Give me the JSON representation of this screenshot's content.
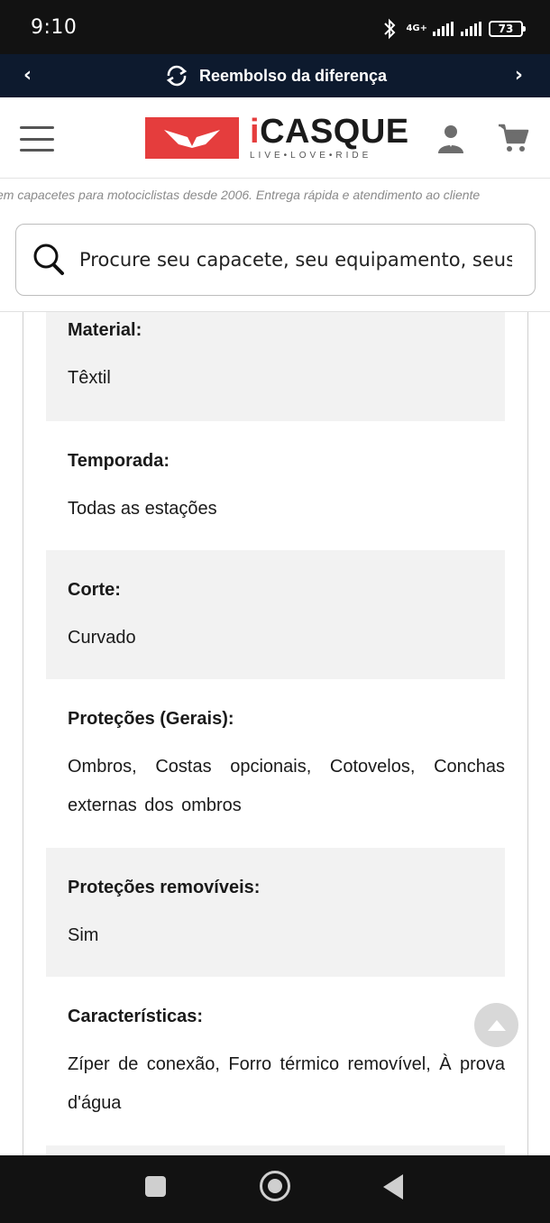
{
  "status_bar": {
    "time": "9:10",
    "network": "4G+",
    "battery": "73"
  },
  "promo": {
    "text": "Reembolso da diferença",
    "prev_icon": "chevron-left-icon",
    "next_icon": "chevron-right-icon"
  },
  "header": {
    "logo_brand": "CASQUE",
    "logo_brand_i": "i",
    "logo_tagline": "LIVE•LOVE•RIDE",
    "menu_icon": "hamburger-menu-icon",
    "user_icon": "user-account-icon",
    "cart_icon": "shopping-cart-icon"
  },
  "tagline": "em capacetes para motociclistas desde 2006. Entrega rápida e atendimento ao cliente",
  "search": {
    "placeholder": "Procure seu capacete, seu equipamento, seus c"
  },
  "specs": [
    {
      "label": "Material:",
      "value": "Têxtil"
    },
    {
      "label": "Temporada:",
      "value": "Todas as estações"
    },
    {
      "label": "Corte:",
      "value": "Curvado"
    },
    {
      "label": "Proteções (Gerais):",
      "value": "Ombros, Costas opcionais, Cotovelos, Conchas externas dos ombros"
    },
    {
      "label": "Proteções removíveis:",
      "value": "Sim"
    },
    {
      "label": "Características:",
      "value": "Zíper de conexão, Forro térmico removível, À prova d'água"
    }
  ],
  "colors": {
    "brand_red": "#e53d3d",
    "promo_bg": "#0d1a2e",
    "shaded_row": "#f2f2f2"
  }
}
